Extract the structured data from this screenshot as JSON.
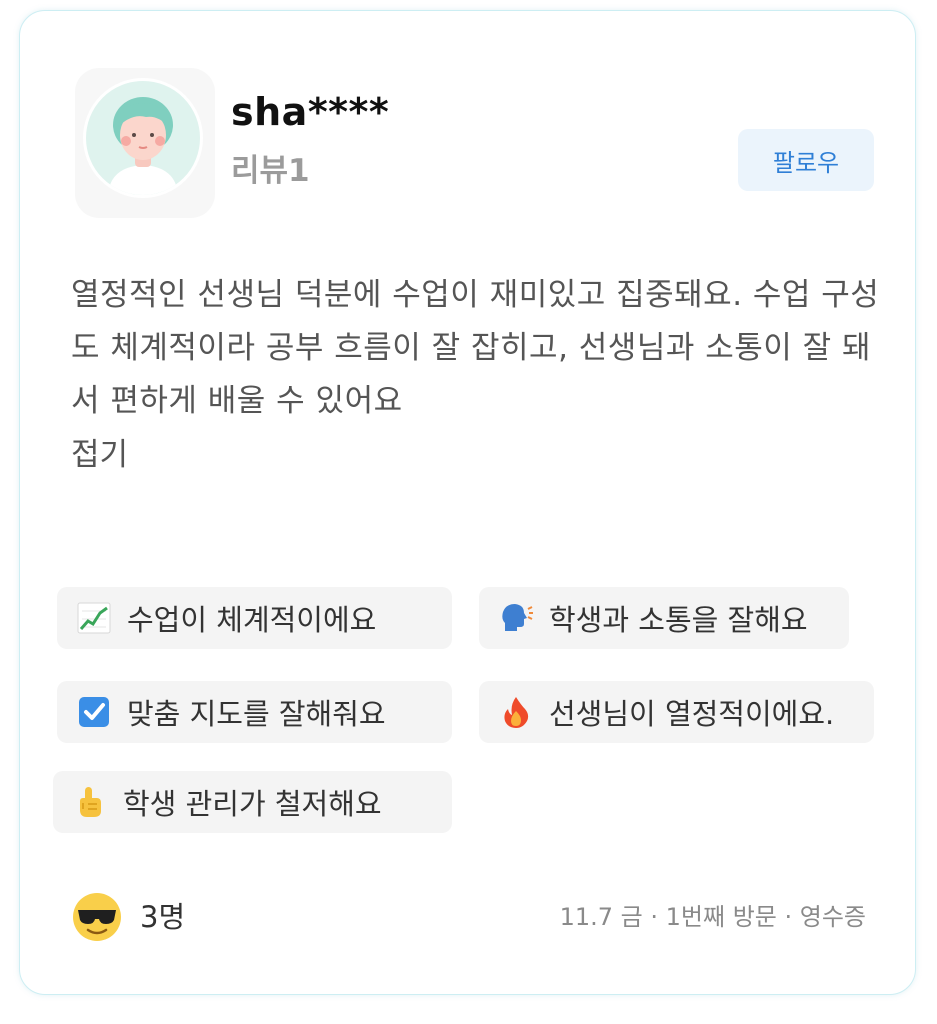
{
  "reviewer": {
    "username": "sha****",
    "review_count": "리뷰1",
    "avatar_icon": "user-avatar-illustration"
  },
  "follow_button": {
    "label": "팔로우",
    "color": "#2f7fd6",
    "background": "#ebf4fc"
  },
  "review": {
    "text": "열정적인 선생님 덕분에 수업이 재미있고 집중돼요. 수업 구성도 체계적이라 공부 흐름이 잘 잡히고, 선생님과 소통이 잘 돼서 편하게 배울 수 있어요",
    "collapse_label": "접기"
  },
  "tags": [
    {
      "icon": "chart-increasing-icon",
      "label": "수업이 체계적이에요"
    },
    {
      "icon": "speaking-head-icon",
      "label": "학생과 소통을 잘해요"
    },
    {
      "icon": "check-box-icon",
      "label": "맞춤 지도를 잘해줘요"
    },
    {
      "icon": "fire-icon",
      "label": "선생님이 열정적이에요."
    },
    {
      "icon": "pointing-up-icon",
      "label": "학생 관리가 철저해요"
    }
  ],
  "footer": {
    "reaction_icon": "sunglasses-face-icon",
    "reaction_count": "3명",
    "visit_info": "11.7 금 · 1번째 방문 · 영수증"
  }
}
